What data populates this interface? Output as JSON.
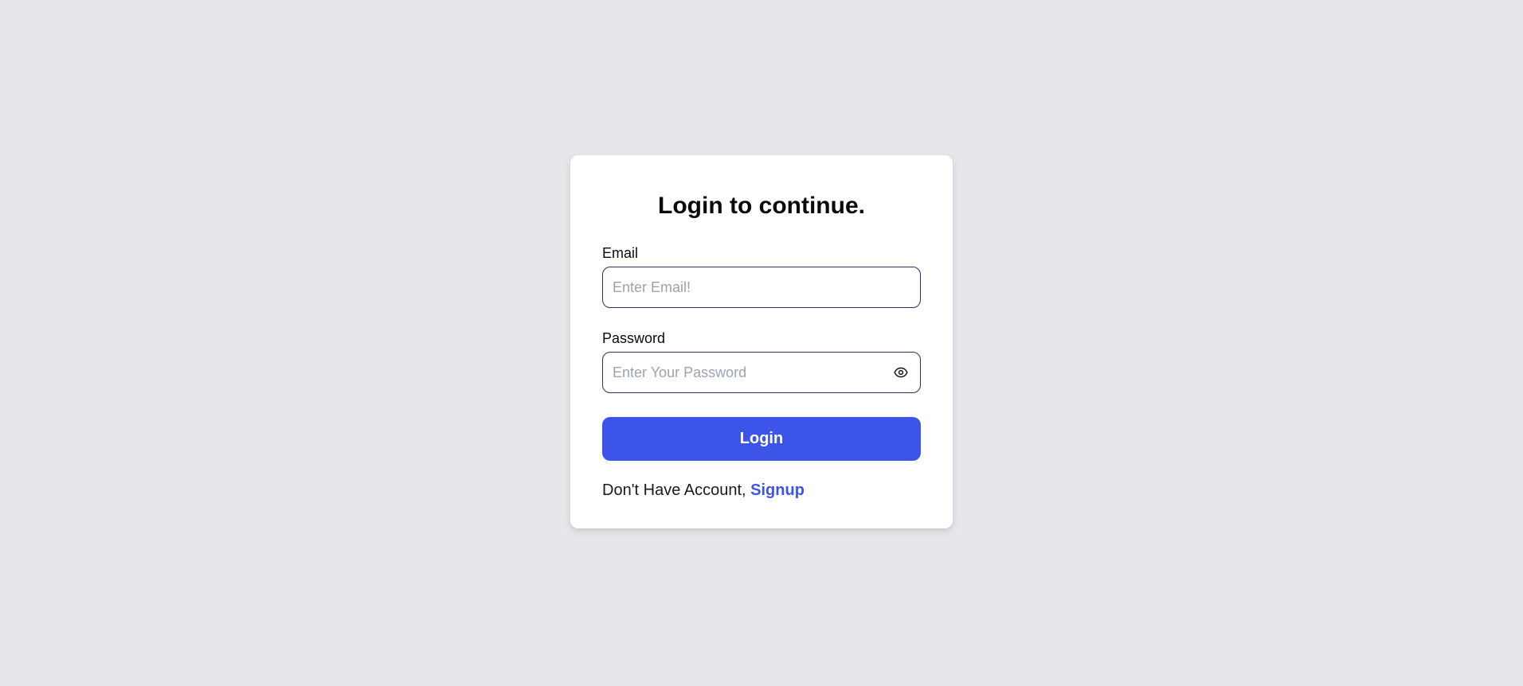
{
  "login_card": {
    "title": "Login to continue.",
    "email": {
      "label": "Email",
      "placeholder": "Enter Email!",
      "value": ""
    },
    "password": {
      "label": "Password",
      "placeholder": "Enter Your Password",
      "value": "",
      "toggle_icon": "eye-icon"
    },
    "login_button_label": "Login",
    "footer": {
      "text": "Don't Have Account, ",
      "signup_link_label": "Signup"
    }
  },
  "colors": {
    "page_background": "#e5e7eb",
    "card_background": "#ffffff",
    "accent": "#3d54e8",
    "input_border": "#2d2f5e",
    "placeholder": "#9ca3af"
  }
}
